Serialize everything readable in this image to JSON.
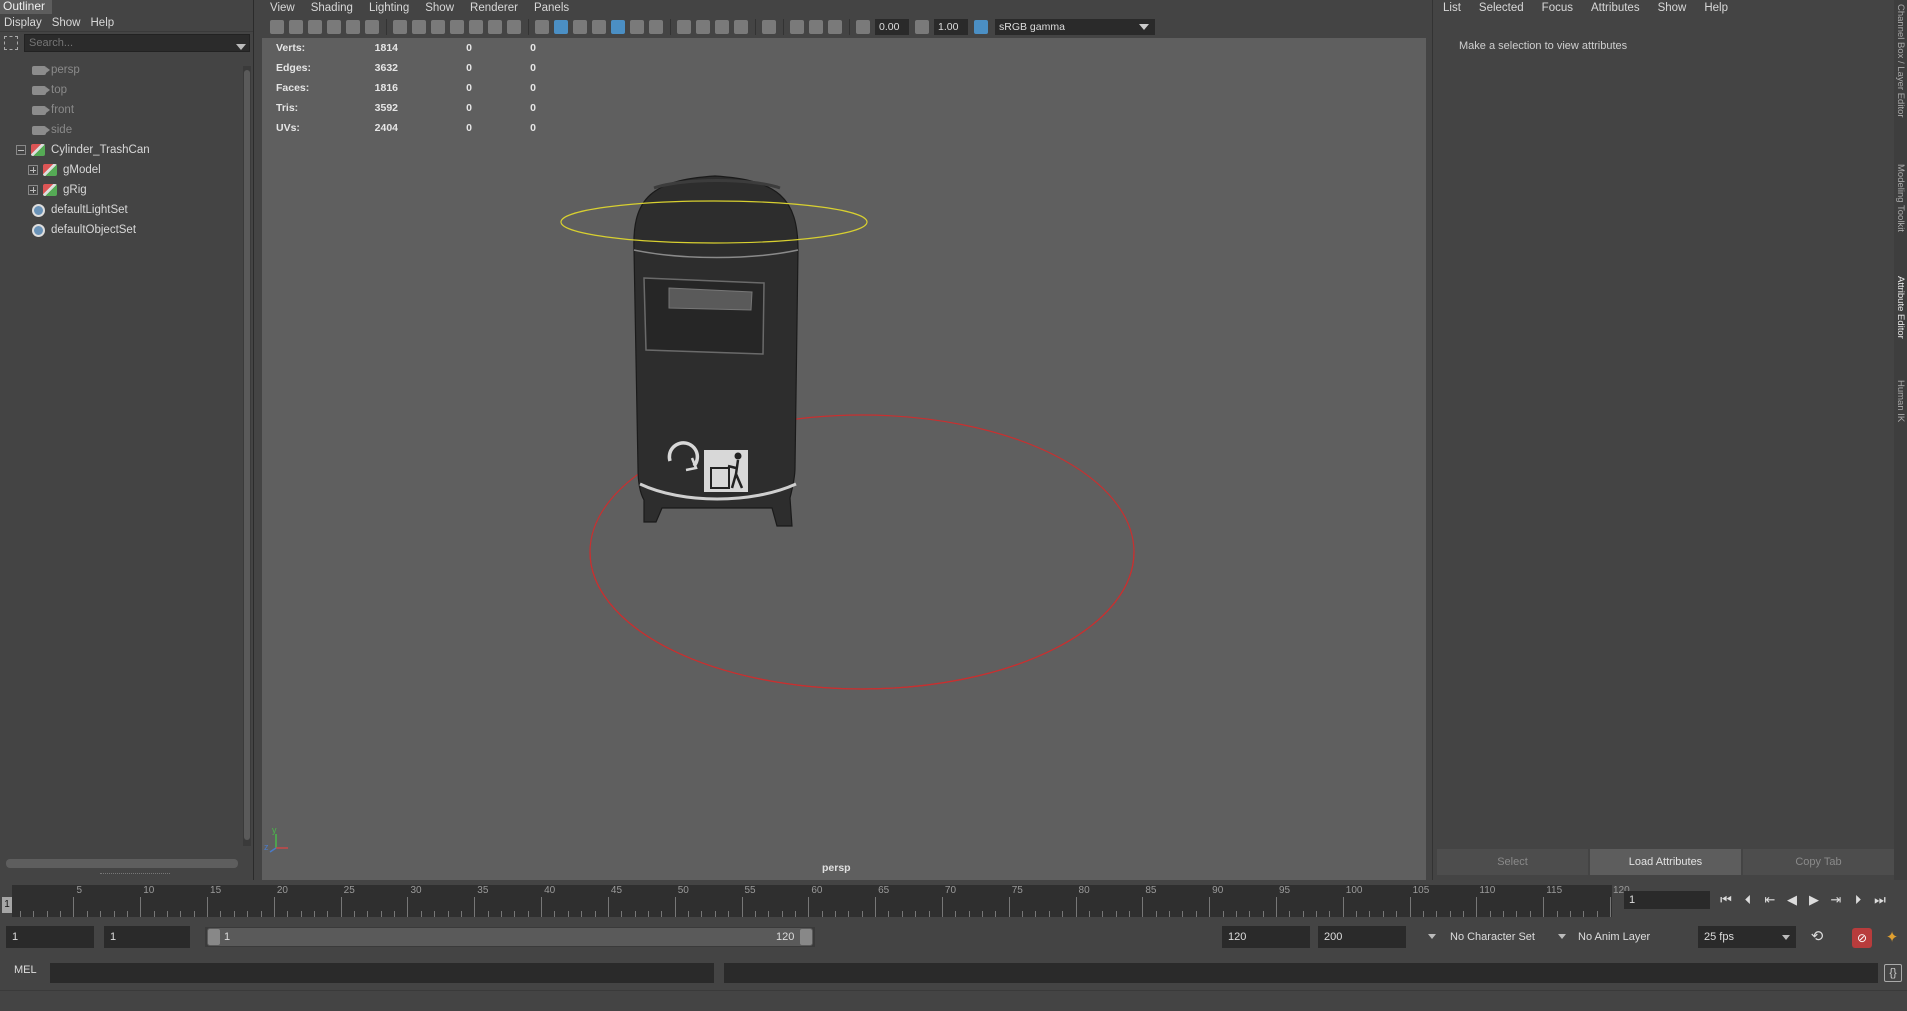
{
  "outliner": {
    "title": "Outliner",
    "menu": [
      "Display",
      "Show",
      "Help"
    ],
    "search_placeholder": "Search...",
    "items": [
      {
        "label": "persp",
        "type": "camera",
        "dim": true
      },
      {
        "label": "top",
        "type": "camera",
        "dim": true
      },
      {
        "label": "front",
        "type": "camera",
        "dim": true
      },
      {
        "label": "side",
        "type": "camera",
        "dim": true
      },
      {
        "label": "Cylinder_TrashCan",
        "type": "transform",
        "expander": "minus"
      },
      {
        "label": "gModel",
        "type": "transform",
        "expander": "plus"
      },
      {
        "label": "gRig",
        "type": "transform",
        "expander": "plus"
      },
      {
        "label": "defaultLightSet",
        "type": "set"
      },
      {
        "label": "defaultObjectSet",
        "type": "set"
      }
    ]
  },
  "viewport": {
    "menu": [
      "View",
      "Shading",
      "Lighting",
      "Show",
      "Renderer",
      "Panels"
    ],
    "exposure": "0.00",
    "gamma": "1.00",
    "color_space": "sRGB gamma",
    "camera": "persp",
    "axis_labels": {
      "x": "x",
      "y": "y",
      "z": "z"
    },
    "hud": [
      {
        "label": "Verts:",
        "v1": "1814",
        "v2": "0",
        "v3": "0"
      },
      {
        "label": "Edges:",
        "v1": "3632",
        "v2": "0",
        "v3": "0"
      },
      {
        "label": "Faces:",
        "v1": "1816",
        "v2": "0",
        "v3": "0"
      },
      {
        "label": "Tris:",
        "v1": "3592",
        "v2": "0",
        "v3": "0"
      },
      {
        "label": "UVs:",
        "v1": "2404",
        "v2": "0",
        "v3": "0"
      }
    ],
    "colors": {
      "bg": "#5f5f5f",
      "ring_top": "#d8d030",
      "ring_bottom": "#c83030",
      "can": "#2d2d2d"
    }
  },
  "attribute_editor": {
    "menu": [
      "List",
      "Selected",
      "Focus",
      "Attributes",
      "Show",
      "Help"
    ],
    "message": "Make a selection to view attributes",
    "buttons": [
      "Select",
      "Load Attributes",
      "Copy Tab"
    ],
    "side_tabs": [
      "Channel Box / Layer Editor",
      "Modeling Toolkit",
      "Attribute Editor",
      "Human IK"
    ]
  },
  "timeline": {
    "ticks": [
      "5",
      "10",
      "15",
      "20",
      "25",
      "30",
      "35",
      "40",
      "45",
      "50",
      "55",
      "60",
      "65",
      "70",
      "75",
      "80",
      "85",
      "90",
      "95",
      "100",
      "105",
      "110",
      "115",
      "120"
    ],
    "current_frame_marker": "1",
    "current_frame": "1",
    "start_frame": "1",
    "playback_start": "1",
    "range_start": "1",
    "range_end": "120",
    "playback_end": "120",
    "animation_end": "200",
    "character_set": "No Character Set",
    "anim_layer": "No Anim Layer",
    "fps": "25 fps"
  },
  "command_line": {
    "label": "MEL"
  }
}
